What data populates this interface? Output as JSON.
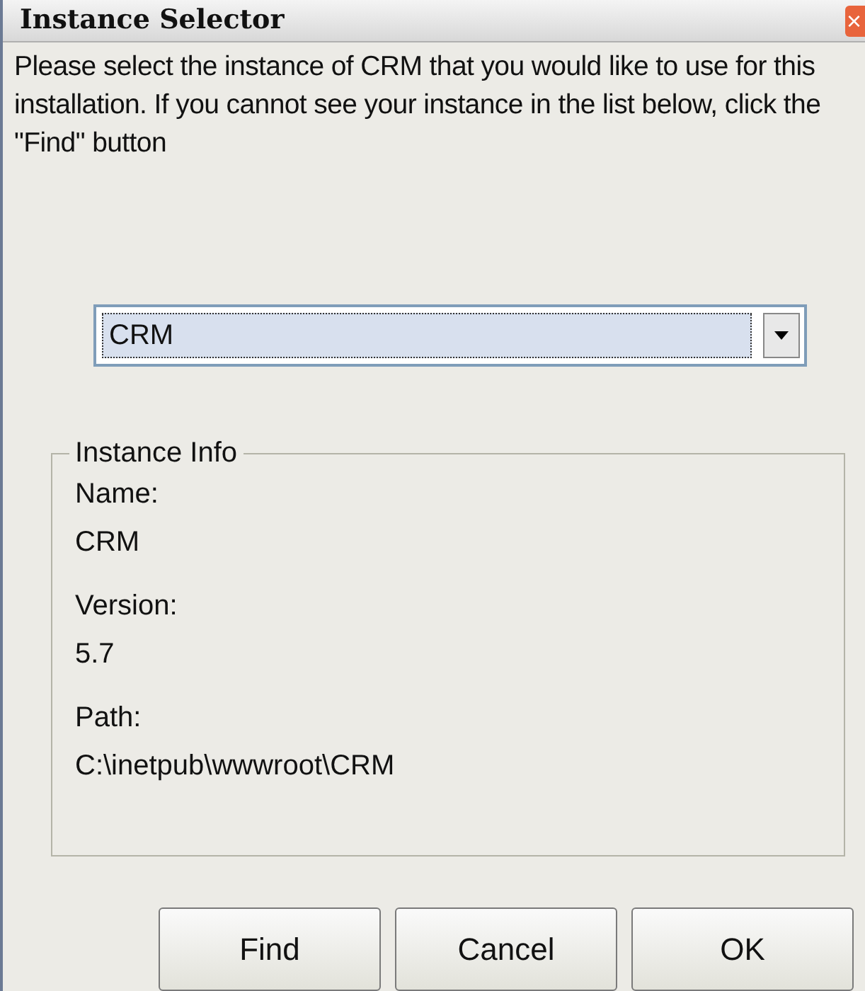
{
  "window": {
    "title": "Instance Selector",
    "close": "×"
  },
  "message": "Please select the instance of CRM that you would like to use for this installation. If you cannot see your instance in the list below, click the \"Find\" button",
  "instance_dropdown": {
    "value": "CRM"
  },
  "instance_info": {
    "legend": "Instance Info",
    "fields": [
      {
        "label": "Name:",
        "value": "CRM"
      },
      {
        "label": "Version:",
        "value": "5.7"
      },
      {
        "label": "Path:",
        "value": "C:\\inetpub\\wwwroot\\CRM"
      }
    ]
  },
  "buttons": [
    "Find",
    "Cancel",
    "OK"
  ]
}
